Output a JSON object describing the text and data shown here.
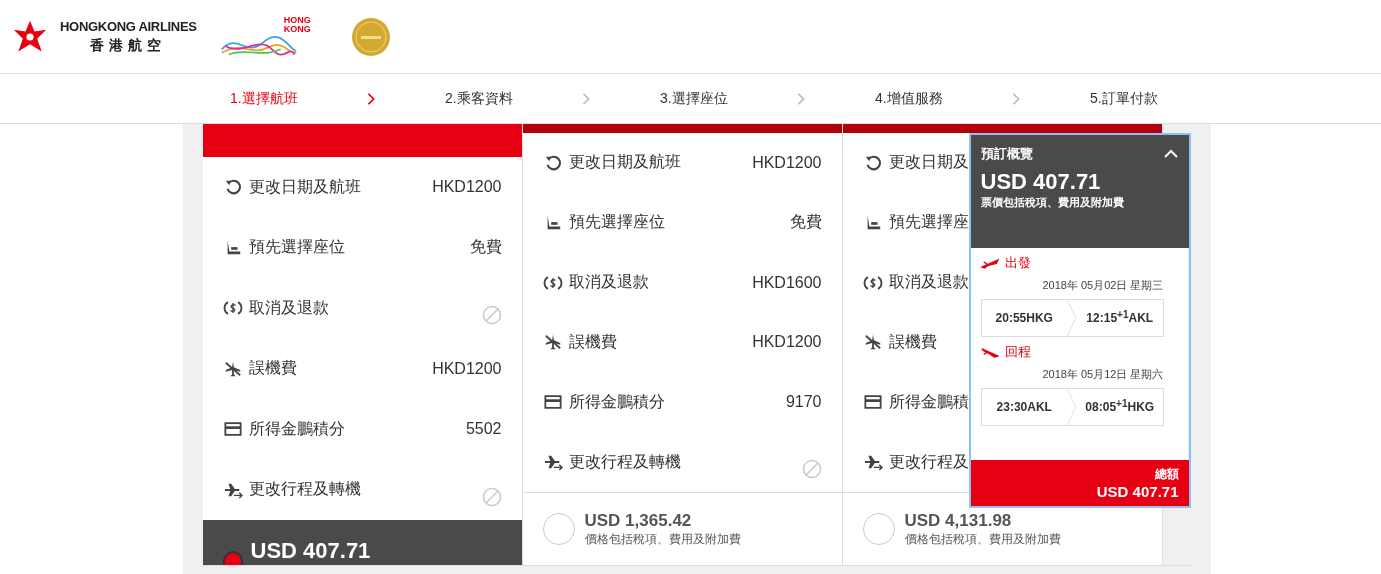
{
  "header": {
    "airline_name": "HONGKONG AIRLINES",
    "airline_name_chinese": "香港航空",
    "city_brand": [
      "HONG",
      "KONG"
    ]
  },
  "steps": [
    {
      "label": "1.選擇航班",
      "selected": true
    },
    {
      "label": "2.乘客資料",
      "selected": false
    },
    {
      "label": "3.選擇座位",
      "selected": false
    },
    {
      "label": "4.增值服務",
      "selected": false
    },
    {
      "label": "5.訂單付款",
      "selected": false
    }
  ],
  "fare_columns": [
    {
      "selected": true,
      "features": [
        {
          "label": "更改日期及航班",
          "kind": "value",
          "value": "HKD1200"
        },
        {
          "label": "預先選擇座位",
          "kind": "value",
          "value": "免費"
        },
        {
          "label": "取消及退款",
          "kind": "unavailable"
        },
        {
          "label": "誤機費",
          "kind": "value",
          "value": "HKD1200"
        },
        {
          "label": "所得金鵬積分",
          "kind": "value",
          "value": "5502"
        },
        {
          "label": "更改行程及轉機",
          "kind": "unavailable"
        }
      ],
      "price": "USD 407.71"
    },
    {
      "selected": false,
      "features": [
        {
          "label": "更改日期及航班",
          "kind": "value",
          "value": "HKD1200"
        },
        {
          "label": "預先選擇座位",
          "kind": "value",
          "value": "免費"
        },
        {
          "label": "取消及退款",
          "kind": "value",
          "value": "HKD1600"
        },
        {
          "label": "誤機費",
          "kind": "value",
          "value": "HKD1200"
        },
        {
          "label": "所得金鵬積分",
          "kind": "value",
          "value": "9170"
        },
        {
          "label": "更改行程及轉機",
          "kind": "unavailable"
        }
      ],
      "price": "USD 1,365.42",
      "price_note": "價格包括稅項、費用及附加費"
    },
    {
      "selected": false,
      "features": [
        {
          "label": "更改日期及",
          "kind": "label_only"
        },
        {
          "label": "預先選擇座",
          "kind": "label_only"
        },
        {
          "label": "取消及退款",
          "kind": "label_only"
        },
        {
          "label": "誤機費",
          "kind": "label_only"
        },
        {
          "label": "所得金鵬積",
          "kind": "label_only"
        },
        {
          "label": "更改行程及",
          "kind": "label_only"
        }
      ],
      "price": "USD 4,131.98",
      "price_note": "價格包括稅項、費用及附加費"
    }
  ],
  "summary": {
    "title": "預訂概覽",
    "expanded": true,
    "price": "USD 407.71",
    "price_note": "票價包括稅項、費用及附加費",
    "legs": [
      {
        "kind": "outbound",
        "label": "出發",
        "date": "2018年 05月02日 星期三",
        "depart_time": "20:55",
        "from": "HKG",
        "arrive_time": "12:15",
        "day_offset": "+1",
        "to": "AKL"
      },
      {
        "kind": "return",
        "label": "回程",
        "date": "2018年 05月12日 星期六",
        "depart_time": "23:30",
        "from": "AKL",
        "arrive_time": "08:05",
        "day_offset": "+1",
        "to": "HKG"
      }
    ],
    "total_label": "總額",
    "total": "USD 407.71"
  }
}
